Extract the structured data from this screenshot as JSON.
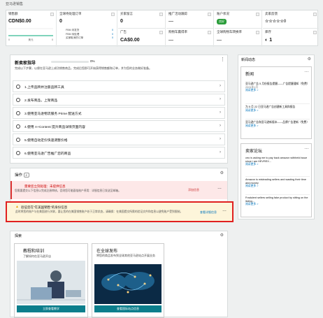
{
  "header": {
    "title": "亚马逊销售"
  },
  "metrics": [
    {
      "title": "销售额",
      "value": "CDN$0.00",
      "sub": [
        "0",
        "美元",
        "0"
      ]
    },
    {
      "title": "全球待处理订单",
      "value": "0",
      "sub_rows": [
        [
          "FBM 未发货",
          "0"
        ],
        [
          "FBM 待处理",
          "0"
        ],
        [
          "买家取消的订单",
          "0"
        ]
      ]
    },
    {
      "title": "买家留言",
      "value": "0"
    },
    {
      "title": "推广活动跟踪",
      "value": "—"
    },
    {
      "title": "账户状况",
      "value": "良好"
    },
    {
      "title": "卖家反馈",
      "value": "☆☆☆☆☆0"
    },
    {
      "title": "全球促销",
      "value": ""
    },
    {
      "title": "广告",
      "value": "CA$0.00"
    },
    {
      "title": "购物车赢得率",
      "value": "—"
    },
    {
      "title": "全球购物车转换率",
      "value": "—"
    },
    {
      "title": "库存",
      "value": "1"
    }
  ],
  "guide": {
    "title": "新卖家指导",
    "progress_label": "0%",
    "progress": 0,
    "desc": "完成以下步骤，以便在亚马逊上成功销售商品，完成后您即可开始获得销售额和订单，并为您的业务做好准备。",
    "tasks": [
      "1.上传品牌并注册品牌工具",
      "2.发布商品，上架商品",
      "3.使用亚马逊物流服务 Prime 配送方式",
      "4.使用 A+Content 提升商品详情页面内容",
      "5.使用自动定价快速调整价格",
      "6.使用亚马逊广告推广您的商品"
    ]
  },
  "actions": {
    "title": "操作",
    "count": "2",
    "alert1": {
      "title": "需要您立刻处理：未提供信息",
      "body": "您需要提交以下信息以完成注册审核，否则您可能面临账户停用：详细信息已发送至邮箱。",
      "link": "添加信息"
    },
    "alert2": {
      "title": "验证您在\"在美国销售\"的身份信息",
      "body": "此时将您的账户与在美国进行关联，要让您的在美国销售账户处于正常状态，请确保：在美国提交所需的验证文件和信息以避免账户受到限制。",
      "link": "查看详细信息"
    }
  },
  "explore": {
    "title": "探索",
    "cards": [
      {
        "title": "教程和培训",
        "desc": "了解如何在亚马逊开店",
        "button": "立即查看教学"
      },
      {
        "title": "在全球发布",
        "desc": "将您的商品发布到全球其他亚马逊站点开展业务",
        "button": "查看国际站点信息"
      }
    ]
  },
  "sidebar": {
    "title": "新闻动态",
    "news": {
      "heading": "新闻",
      "items": [
        {
          "text": "亚马逊广告 5 月份报告提醒——广告提醒通知（免费）",
          "date": "2024年1月",
          "more": "阅读更多 >"
        },
        {
          "text": "为 5 月 22 日亚马逊广告创建新工具和报告",
          "date": "",
          "more": "阅读更多 >"
        },
        {
          "text": "亚马逊广告和亚马逊新版本——品牌广告更新（免费）",
          "date": "",
          "more": "阅读更多 >"
        }
      ]
    },
    "forum": {
      "heading": "卖家论坛",
      "items": [
        {
          "text": "ceo is asking me to pay back amazon withheld issue since i am HEVREX...",
          "more": "阅读更多 >"
        },
        {
          "text": "Amazon is misleading sellers and wasting their time and money",
          "more": "阅读更多 >"
        },
        {
          "text": "Fradulent sellers selling fake product by sitting on the listing...",
          "more": "阅读更多 >"
        }
      ]
    }
  }
}
